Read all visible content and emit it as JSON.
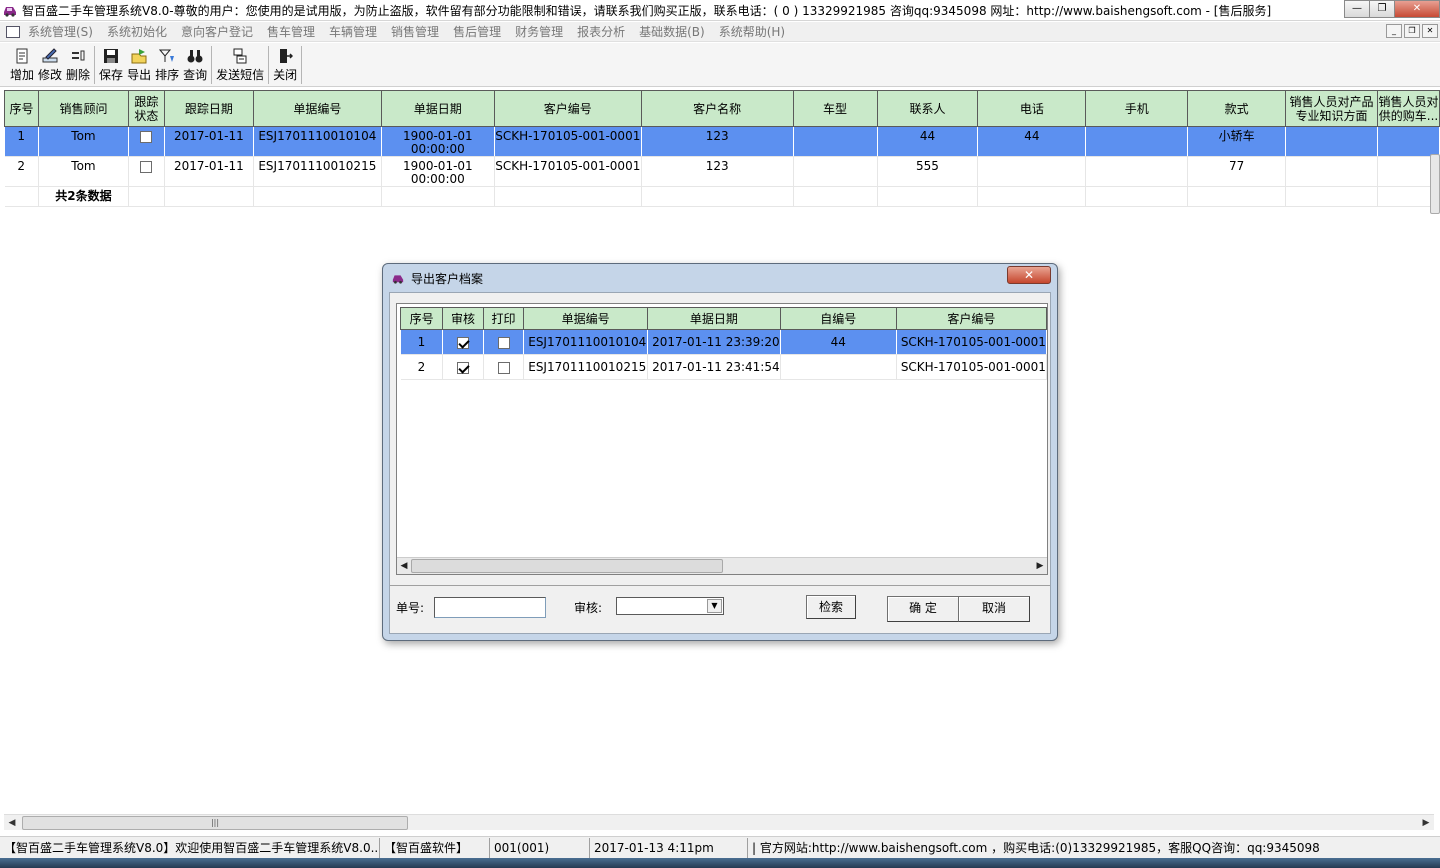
{
  "window": {
    "title": "智百盛二手车管理系统V8.0-尊敬的用户：您使用的是试用版，为防止盗版，软件留有部分功能限制和错误，请联系我们购买正版，联系电话：( 0 ) 13329921985  咨询qq:9345098   网址：http://www.baishengsoft.com - [售后服务]",
    "close_label": "✕",
    "min_label": "—",
    "max_label": "❐"
  },
  "menu": [
    "系统管理(S)",
    "系统初始化",
    "意向客户登记",
    "售车管理",
    "车辆管理",
    "销售管理",
    "售后管理",
    "财务管理",
    "报表分析",
    "基础数据(B)",
    "系统帮助(H)"
  ],
  "toolbar": [
    {
      "label": "增加",
      "icon": "add-doc-icon"
    },
    {
      "label": "修改",
      "icon": "edit-icon"
    },
    {
      "label": "删除",
      "icon": "delete-icon"
    },
    {
      "label": "保存",
      "icon": "save-icon"
    },
    {
      "label": "导出",
      "icon": "export-icon"
    },
    {
      "label": "排序",
      "icon": "sort-icon"
    },
    {
      "label": "查询",
      "icon": "binoculars-icon"
    },
    {
      "label": "发送短信",
      "icon": "sms-icon"
    },
    {
      "label": "关闭",
      "icon": "close-door-icon"
    }
  ],
  "main_table": {
    "headers": [
      "序号",
      "销售顾问",
      "跟踪\n状态",
      "跟踪日期",
      "单据编号",
      "单据日期",
      "客户编号",
      "客户名称",
      "车型",
      "联系人",
      "电话",
      "手机",
      "款式",
      "销售人员对产品\n专业知识方面",
      "销售人员对\n供的购车..."
    ],
    "rows": [
      {
        "seq": "1",
        "advisor": "Tom",
        "tracked": false,
        "track_date": "2017-01-11",
        "doc_no": "ESJ1701110010104",
        "doc_date": "1900-01-01",
        "doc_time": "00:00:00",
        "cust_no": "SCKH-170105-001-0001",
        "cust_name": "123",
        "model": "",
        "contact": "44",
        "phone": "44",
        "mobile": "",
        "style": "小轿车",
        "q1": "",
        "q2": ""
      },
      {
        "seq": "2",
        "advisor": "Tom",
        "tracked": false,
        "track_date": "2017-01-11",
        "doc_no": "ESJ1701110010215",
        "doc_date": "1900-01-01",
        "doc_time": "00:00:00",
        "cust_no": "SCKH-170105-001-0001",
        "cust_name": "123",
        "model": "",
        "contact": "555",
        "phone": "",
        "mobile": "",
        "style": "77",
        "q1": "",
        "q2": ""
      }
    ],
    "summary": "共2条数据"
  },
  "dialog": {
    "title": "导出客户档案",
    "close_label": "✕",
    "headers": [
      "序号",
      "审核",
      "打印",
      "单据编号",
      "单据日期",
      "自编号",
      "客户编号"
    ],
    "rows": [
      {
        "seq": "1",
        "audited": true,
        "printed": false,
        "doc_no": "ESJ1701110010104",
        "doc_date": "2017-01-11 23:39:20",
        "self_no": "44",
        "cust_no": "SCKH-170105-001-0001"
      },
      {
        "seq": "2",
        "audited": true,
        "printed": false,
        "doc_no": "ESJ1701110010215",
        "doc_date": "2017-01-11 23:41:54",
        "self_no": "",
        "cust_no": "SCKH-170105-001-0001"
      }
    ],
    "doc_no_label": "单号:",
    "doc_no_value": "",
    "audit_label": "审核:",
    "audit_value": "",
    "search_label": "检索",
    "ok_label": "确 定",
    "cancel_label": "取消"
  },
  "statusbar": [
    "【智百盛二手车管理系统V8.0】欢迎使用智百盛二手车管理系统V8.0...",
    "【智百盛软件】",
    "001(001)",
    "2017-01-13 4:11pm",
    "|  官方网站:http://www.baishengsoft.com ，购买电话:(0)13329921985，客服QQ咨询：qq:9345098"
  ],
  "colors": {
    "header_green": "#c9e9c9",
    "selection_blue": "#5c90f0",
    "dialog_frame": "#c5d5e8"
  }
}
